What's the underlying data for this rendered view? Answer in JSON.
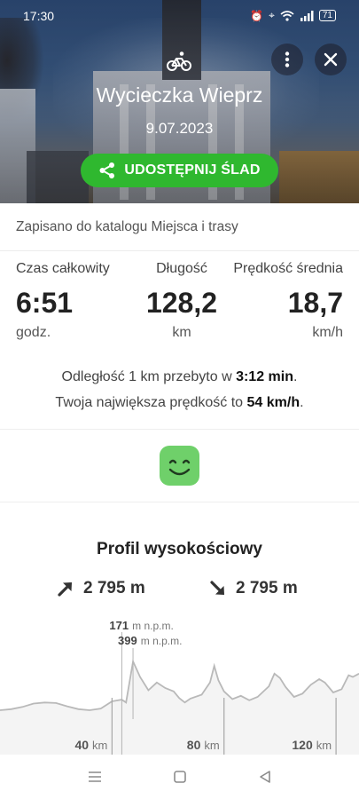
{
  "status_bar": {
    "time": "17:30",
    "battery": "71"
  },
  "header": {
    "title": "Wycieczka Wieprz",
    "date": "9.07.2023",
    "share_label": "UDOSTĘPNIJ ŚLAD",
    "icons": {
      "activity": "bike-icon",
      "more": "more-vertical-icon",
      "close": "close-icon",
      "share": "share-icon"
    }
  },
  "saved_note": "Zapisano do katalogu Miejsca i trasy",
  "stats": [
    {
      "label": "Czas całkowity",
      "value": "6:51",
      "unit": "godz."
    },
    {
      "label": "Długość",
      "value": "128,2",
      "unit": "km"
    },
    {
      "label": "Prędkość średnia",
      "value": "18,7",
      "unit": "km/h"
    }
  ],
  "info": {
    "line1_prefix": "Odległość 1 km przebyto w ",
    "line1_value": "3:12 min",
    "line1_suffix": ".",
    "line2_prefix": "Twoja największa prędkość to ",
    "line2_value": "54 km/h",
    "line2_suffix": "."
  },
  "mood_icon": "smiley-icon",
  "profile": {
    "title": "Profil wysokościowy",
    "ascent": "2 795 m",
    "descent": "2 795 m",
    "min_value": "171",
    "max_value": "399",
    "elev_unit": "m n.p.m.",
    "distance_marks": [
      {
        "value": "40",
        "unit": "km"
      },
      {
        "value": "80",
        "unit": "km"
      },
      {
        "value": "120",
        "unit": "km"
      }
    ],
    "total_km": 128.2,
    "min_at_km": 43.5,
    "max_at_km": 47.5,
    "profile_points": [
      [
        0,
        212
      ],
      [
        4,
        214
      ],
      [
        8,
        218
      ],
      [
        12,
        224
      ],
      [
        16,
        226
      ],
      [
        20,
        225
      ],
      [
        24,
        219
      ],
      [
        28,
        214
      ],
      [
        32,
        212
      ],
      [
        36,
        215
      ],
      [
        40,
        228
      ],
      [
        43.5,
        231
      ],
      [
        45,
        226
      ],
      [
        47.5,
        300
      ],
      [
        50,
        272
      ],
      [
        53,
        248
      ],
      [
        56,
        262
      ],
      [
        59,
        252
      ],
      [
        62,
        246
      ],
      [
        64,
        234
      ],
      [
        66,
        226
      ],
      [
        68,
        233
      ],
      [
        72,
        240
      ],
      [
        75,
        262
      ],
      [
        76.5,
        292
      ],
      [
        78,
        266
      ],
      [
        80,
        246
      ],
      [
        83,
        232
      ],
      [
        86,
        238
      ],
      [
        89,
        230
      ],
      [
        92,
        236
      ],
      [
        96,
        255
      ],
      [
        98,
        278
      ],
      [
        100,
        270
      ],
      [
        102,
        254
      ],
      [
        105,
        236
      ],
      [
        108,
        242
      ],
      [
        111,
        258
      ],
      [
        114,
        268
      ],
      [
        116,
        262
      ],
      [
        119,
        244
      ],
      [
        122,
        250
      ],
      [
        124.5,
        275
      ],
      [
        126,
        272
      ],
      [
        128.2,
        278
      ]
    ]
  },
  "nav": {
    "menu": "menu-icon",
    "home": "home-icon",
    "back": "back-icon"
  }
}
